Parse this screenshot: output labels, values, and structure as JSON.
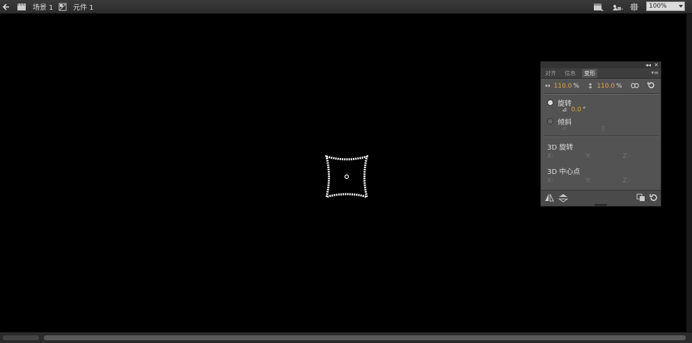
{
  "topbar": {
    "scene_label": "场景 1",
    "symbol_label": "元件 1",
    "zoom_value": "100%"
  },
  "panel": {
    "tabs": [
      {
        "label": "对齐"
      },
      {
        "label": "信息"
      },
      {
        "label": "变形"
      }
    ],
    "width_value": "110.0",
    "height_value": "110.0",
    "percent": "%",
    "rotate_label": "旋转",
    "rotate_value": "0.0",
    "degree": "°",
    "skew_label": "倾斜",
    "rotate3d_label": "3D 旋转",
    "center3d_label": "3D 中心点",
    "x_label": "X:",
    "y_label": "Y:",
    "z_label": "Z:"
  },
  "colors": {
    "accent_value": "#e8a33d",
    "panel_bg": "#535353",
    "stage_bg": "#000000"
  },
  "icons": [
    "back-arrow-icon",
    "scene-clapper-icon",
    "symbol-icon",
    "edit-scene-icon",
    "edit-symbol-icon",
    "center-stage-icon",
    "link-icon",
    "reset-icon",
    "flip-horizontal-icon",
    "flip-vertical-icon",
    "duplicate-transform-icon",
    "reset-transform-icon"
  ]
}
